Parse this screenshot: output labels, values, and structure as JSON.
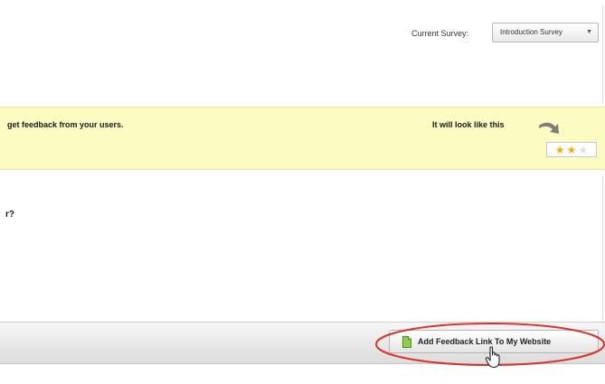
{
  "header": {
    "survey_label": "Current Survey:",
    "survey_select_value": "Introduction Survey"
  },
  "banner": {
    "message": "get feedback from your users.",
    "preview_label": "It will look like this",
    "preview_rating": {
      "filled": 2,
      "total": 3
    }
  },
  "main": {
    "question_fragment": "r?"
  },
  "footer": {
    "add_link_button_label": "Add Feedback Link To My Website"
  },
  "colors": {
    "banner_background": "#fbfbc2",
    "highlight_ellipse": "#d9342b",
    "star_filled": "#f0b000"
  },
  "icons": [
    "chevron-down-icon",
    "curved-arrow-icon",
    "star-icon",
    "document-icon",
    "hand-cursor-icon"
  ]
}
